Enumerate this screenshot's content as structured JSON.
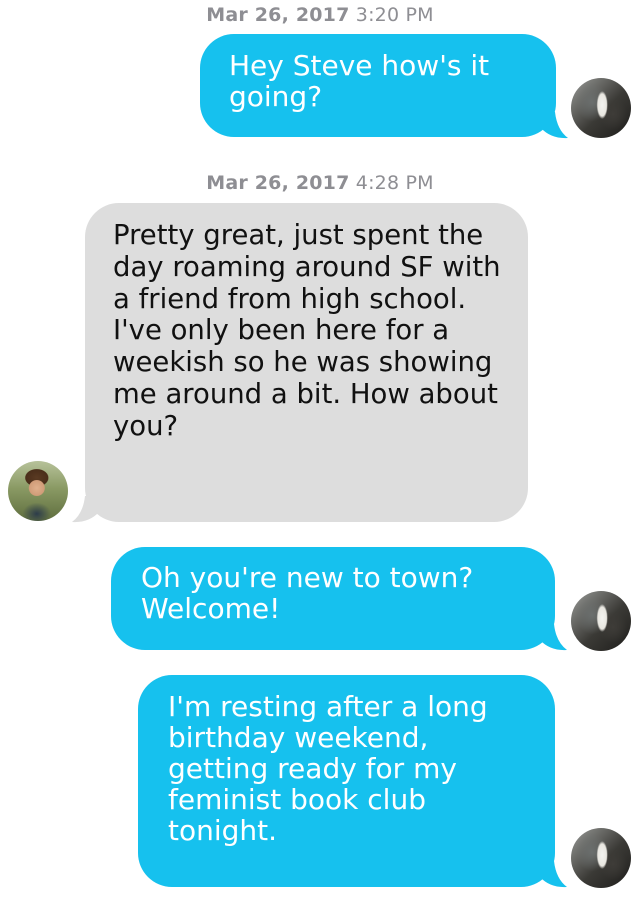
{
  "conversation": {
    "timestamps": [
      {
        "date": "Mar 26, 2017",
        "time": "3:20 PM"
      },
      {
        "date": "Mar 26, 2017",
        "time": "4:28 PM"
      }
    ],
    "messages": [
      {
        "sender": "me",
        "text": "Hey Steve how's it going?"
      },
      {
        "sender": "steve",
        "text": "Pretty great, just spent the day roaming around SF with a friend from high school. I've only been here for a weekish so he was showing me around a bit. How about you?"
      },
      {
        "sender": "me",
        "text": "Oh you're new to town? Welcome!"
      },
      {
        "sender": "me",
        "text": "I'm resting after a long birthday weekend, getting ready for my feminist book club tonight."
      }
    ]
  },
  "colors": {
    "outgoing_bubble": "#16c1ee",
    "incoming_bubble": "#dddddd",
    "timestamp": "#8e8e93"
  },
  "avatars": {
    "me": "profile-photo",
    "steve": "profile-photo"
  }
}
